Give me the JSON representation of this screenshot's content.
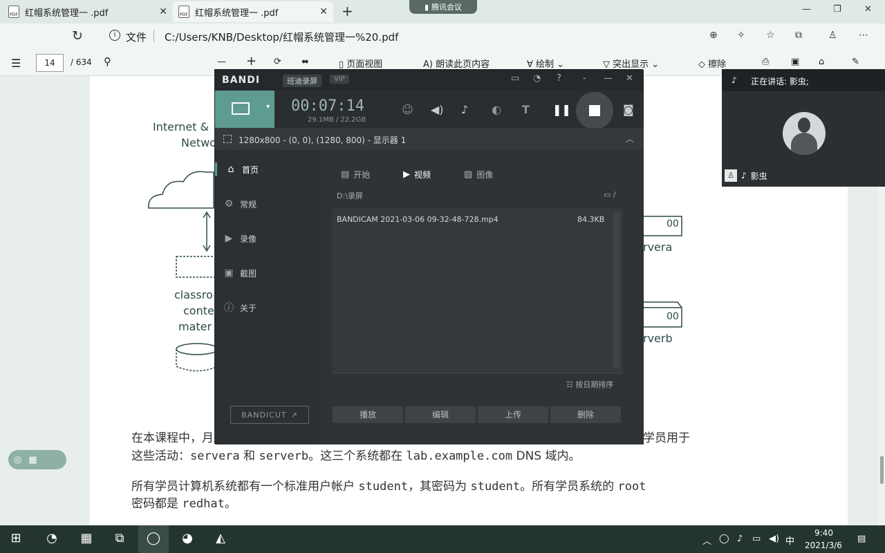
{
  "browser": {
    "tabs": [
      {
        "label": "红帽系统管理一 .pdf",
        "close": "✕"
      },
      {
        "label": "红帽系统管理一 .pdf",
        "close": "✕"
      }
    ],
    "new_tab": "+",
    "meeting_pill": "腾讯会议",
    "window_controls": {
      "minimize": "—",
      "maximize": "❐",
      "close": "✕"
    },
    "file_label": "文件",
    "url": "C:/Users/KNB/Desktop/红帽系统管理一%20.pdf"
  },
  "pdf_toolbar": {
    "page_current": "14",
    "page_total": "/ 634",
    "page_view": "页面视图",
    "read_aloud": "朗读此页内容",
    "draw": "绘制",
    "highlight": "突出显示",
    "erase": "擦除"
  },
  "pdf_content": {
    "diagram": {
      "internet_label_1": "Internet &",
      "internet_label_2": "Netwo",
      "classroom_1": "classro",
      "classroom_2": "conte",
      "classroom_3": "mater",
      "servera_label": "rvera",
      "serverb_label": "rverb",
      "server_port": "00"
    },
    "para1_start": "在本课程中，月",
    "para1_end": "学员用于",
    "para2_a": "这些活动：",
    "para2_servera": "servera",
    "para2_and": " 和 ",
    "para2_serverb": "serverb",
    "para2_b": "。这三个系统都在 ",
    "para2_domain": "lab.example.com",
    "para2_c": " DNS 域内。",
    "para3_a": "所有学员计算机系统都有一个标准用户帐户 ",
    "para3_user": "student",
    "para3_b": "，其密码为 ",
    "para3_pw": "student",
    "para3_c": "。所有学员系统的 ",
    "para3_root": "root",
    "para4_a": "密码都是 ",
    "para4_pw": "redhat",
    "para4_b": "。"
  },
  "bandicam": {
    "logo": "BANDI",
    "badge": "班迪录屏",
    "vip": "VIP",
    "timer": "00:07:14",
    "size": "29.1MB / 22.2GB",
    "region": "1280x800 - (0, 0), (1280, 800) - 显示器 1",
    "nav": [
      "首页",
      "常规",
      "录像",
      "截图",
      "关于"
    ],
    "bandicut": "BANDICUT",
    "tabs": {
      "start": "开始",
      "video": "视频",
      "image": "图像"
    },
    "path": "D:\\录屏",
    "path_right": "/",
    "files": [
      {
        "name": "BANDICAM 2021-03-06 09-32-48-728.mp4",
        "size": "84.3KB"
      }
    ],
    "sort": "按日期排序",
    "buttons": [
      "播放",
      "编辑",
      "上传",
      "删除"
    ]
  },
  "meeting": {
    "speaking": "正在讲话: 影虫;",
    "participant": "影虫"
  },
  "taskbar": {
    "ime": "中",
    "time": "9:40",
    "date": "2021/3/6"
  }
}
